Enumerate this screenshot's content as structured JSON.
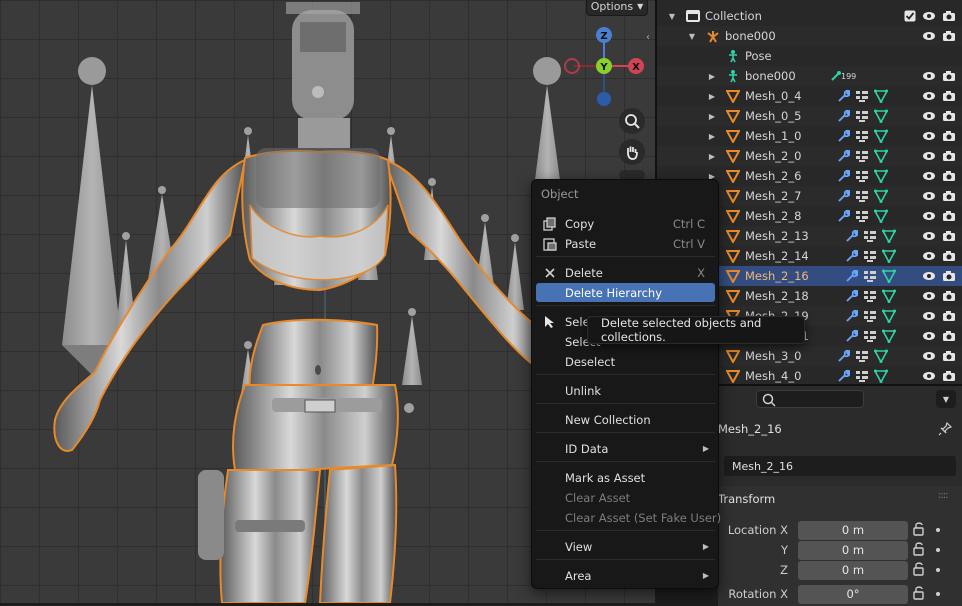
{
  "viewport": {
    "options_label": "Options"
  },
  "outliner": {
    "rows": [
      {
        "name": "Collection",
        "type": "collection"
      },
      {
        "name": "bone000",
        "type": "armature-object"
      },
      {
        "name": "Pose",
        "type": "pose"
      },
      {
        "name": "bone000",
        "type": "armature-data",
        "badge": "199"
      },
      {
        "name": "Mesh_0_4",
        "type": "mesh"
      },
      {
        "name": "Mesh_0_5",
        "type": "mesh"
      },
      {
        "name": "Mesh_1_0",
        "type": "mesh"
      },
      {
        "name": "Mesh_2_0",
        "type": "mesh"
      },
      {
        "name": "Mesh_2_6",
        "type": "mesh"
      },
      {
        "name": "Mesh_2_7",
        "type": "mesh"
      },
      {
        "name": "Mesh_2_8",
        "type": "mesh"
      },
      {
        "name": "Mesh_2_13",
        "type": "mesh"
      },
      {
        "name": "Mesh_2_14",
        "type": "mesh"
      },
      {
        "name": "Mesh_2_16",
        "type": "mesh",
        "selected": true
      },
      {
        "name": "Mesh_2_18",
        "type": "mesh"
      },
      {
        "name": "Mesh_2_19",
        "type": "mesh"
      },
      {
        "name": "Mesh_2_21",
        "type": "mesh"
      },
      {
        "name": "Mesh_3_0",
        "type": "mesh"
      },
      {
        "name": "Mesh_4_0",
        "type": "mesh"
      }
    ]
  },
  "properties": {
    "object_title": "Mesh_2_16",
    "object_name_field": "Mesh_2_16",
    "transform_title": "Transform",
    "rows": [
      {
        "label": "Location X",
        "value": "0 m"
      },
      {
        "label": "Y",
        "value": "0 m"
      },
      {
        "label": "Z",
        "value": "0 m"
      },
      {
        "label": "Rotation X",
        "value": "0°"
      }
    ]
  },
  "context_menu": {
    "title": "Object",
    "items": [
      {
        "label": "Copy",
        "shortcut": "Ctrl C",
        "icon": "copy-icon"
      },
      {
        "label": "Paste",
        "shortcut": "Ctrl V",
        "icon": "paste-icon"
      },
      {
        "label": "Delete",
        "shortcut": "X",
        "icon": "x-icon"
      },
      {
        "label": "Delete Hierarchy",
        "active": true
      },
      {
        "label": "Select",
        "icon": "cursor-icon"
      },
      {
        "label": "Select"
      },
      {
        "label": "Deselect"
      },
      {
        "label": "Unlink"
      },
      {
        "label": "New Collection"
      },
      {
        "label": "ID Data",
        "submenu": true
      },
      {
        "label": "Mark as Asset"
      },
      {
        "label": "Clear Asset",
        "disabled": true
      },
      {
        "label": "Clear Asset (Set Fake User)",
        "disabled": true
      },
      {
        "label": "View",
        "submenu": true
      },
      {
        "label": "Area",
        "submenu": true
      }
    ]
  },
  "tooltip": {
    "text": "Delete selected objects and collections."
  },
  "colors": {
    "selection_outline": "#e8892a",
    "menu_active": "#4772b3",
    "outliner_selected": "#334d80",
    "mesh_icon": "#e8892a",
    "modifier_icon": "#6aa7ff",
    "data_icon": "#2fd3a6"
  }
}
